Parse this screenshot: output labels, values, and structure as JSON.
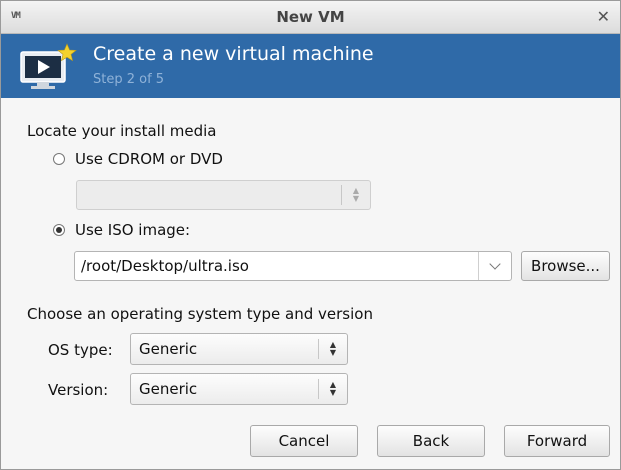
{
  "window": {
    "title": "New VM",
    "app_icon_text": "VM"
  },
  "banner": {
    "title": "Create a new virtual machine",
    "step": "Step 2 of 5",
    "bg_color": "#2f6aa8"
  },
  "install_media": {
    "heading": "Locate your install media",
    "cdrom_label": "Use CDROM or DVD",
    "cdrom_selected": false,
    "cdrom_value": "",
    "iso_label": "Use ISO image:",
    "iso_selected": true,
    "iso_path": "/root/Desktop/ultra.iso",
    "browse_label": "Browse..."
  },
  "os_section": {
    "heading": "Choose an operating system type and version",
    "os_type_label": "OS type:",
    "os_type_value": "Generic",
    "version_label": "Version:",
    "version_value": "Generic"
  },
  "footer": {
    "cancel_label": "Cancel",
    "back_label": "Back",
    "forward_label": "Forward"
  }
}
